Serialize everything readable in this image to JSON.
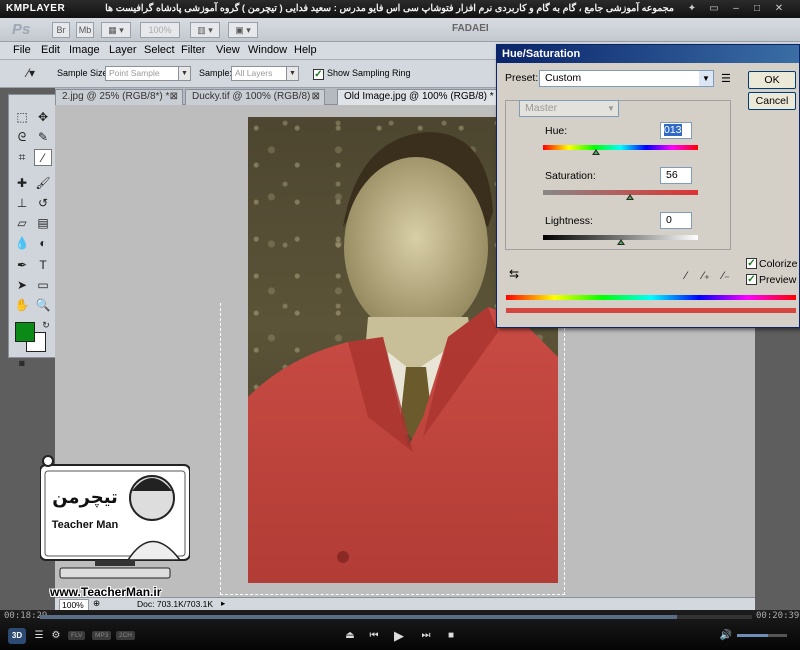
{
  "kmplayer": {
    "logo": "KMPLAYER",
    "caption": "مجموعه آموزشی جامع ، گام به گام و کاربردی نرم افزار فتوشاپ سی اس فایو  مدرس : سعید فدایی ( تیچرمن ) گروه آموزشی پادشاه گرافیست ها",
    "elapsed": "00:18:29",
    "total": "00:20:39",
    "progress_fraction": 0.894,
    "volume_fraction": 0.62,
    "badges": [
      "FLV",
      "MP3",
      "2CH"
    ],
    "btn_3d": "3D"
  },
  "photoshop": {
    "logo": "Ps",
    "br_label": "Br",
    "mb_label": "Mb",
    "zoom_display": "100%",
    "workspace_label": "FADAEI",
    "menu": [
      "File",
      "Edit",
      "Image",
      "Layer",
      "Select",
      "Filter",
      "View",
      "Window",
      "Help"
    ],
    "options": {
      "sample_size_label": "Sample Size:",
      "sample_size_value": "Point Sample",
      "sample_label": "Sample:",
      "sample_value": "All Layers",
      "show_ring_label": "Show Sampling Ring",
      "show_ring_checked": true
    },
    "tabs": [
      {
        "label": "2.jpg @ 25% (RGB/8*) *",
        "active": false
      },
      {
        "label": "Ducky.tif @ 100% (RGB/8)",
        "active": false
      },
      {
        "label": "Old Image.jpg @ 100% (RGB/8) *",
        "active": true
      }
    ],
    "status": {
      "zoom": "100%",
      "doc": "Doc: 703.1K/703.1K"
    },
    "colors": {
      "foreground": "#0b8a17",
      "background": "#ffffff"
    }
  },
  "dialog": {
    "title": "Hue/Saturation",
    "preset_label": "Preset:",
    "preset_value": "Custom",
    "channel_value": "Master",
    "hue_label": "Hue:",
    "hue_value": "013",
    "hue_fraction": 0.34,
    "saturation_label": "Saturation:",
    "saturation_value": "56",
    "saturation_fraction": 0.56,
    "lightness_label": "Lightness:",
    "lightness_value": "0",
    "lightness_fraction": 0.5,
    "ok_label": "OK",
    "cancel_label": "Cancel",
    "colorize_label": "Colorize",
    "colorize_checked": true,
    "preview_label": "Preview",
    "preview_checked": true
  },
  "watermark": {
    "logo_text": "تیچرمن",
    "logo_sub": "Teacher Man",
    "url": "www.TeacherMan.ir"
  }
}
